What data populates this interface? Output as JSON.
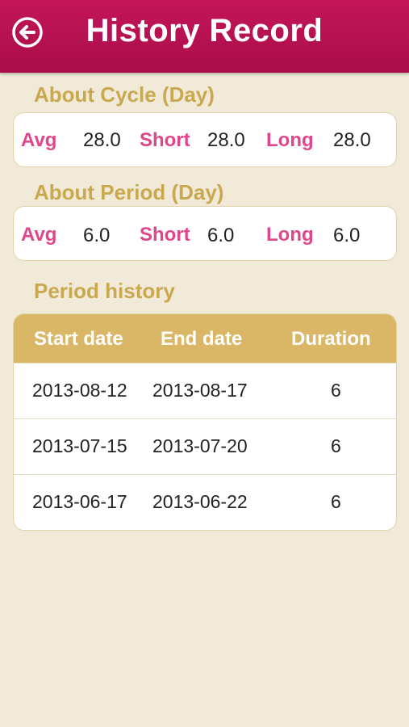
{
  "header": {
    "title": "History Record",
    "back_icon": "back-arrow-circle-icon"
  },
  "cycle": {
    "title": "About Cycle (Day)",
    "avg_label": "Avg",
    "avg_value": "28.0",
    "short_label": "Short",
    "short_value": "28.0",
    "long_label": "Long",
    "long_value": "28.0"
  },
  "period": {
    "title": "About Period (Day)",
    "avg_label": "Avg",
    "avg_value": "6.0",
    "short_label": "Short",
    "short_value": "6.0",
    "long_label": "Long",
    "long_value": "6.0"
  },
  "history": {
    "title": "Period history",
    "columns": [
      "Start date",
      "End date",
      "Duration"
    ],
    "rows": [
      {
        "start": "2013-08-12",
        "end": "2013-08-17",
        "duration": "6"
      },
      {
        "start": "2013-07-15",
        "end": "2013-07-20",
        "duration": "6"
      },
      {
        "start": "2013-06-17",
        "end": "2013-06-22",
        "duration": "6"
      }
    ]
  },
  "colors": {
    "header": "#b8124f",
    "background": "#f2ead9",
    "section_title": "#c9a84e",
    "stat_label": "#e0468a",
    "table_header": "#d9b767"
  }
}
